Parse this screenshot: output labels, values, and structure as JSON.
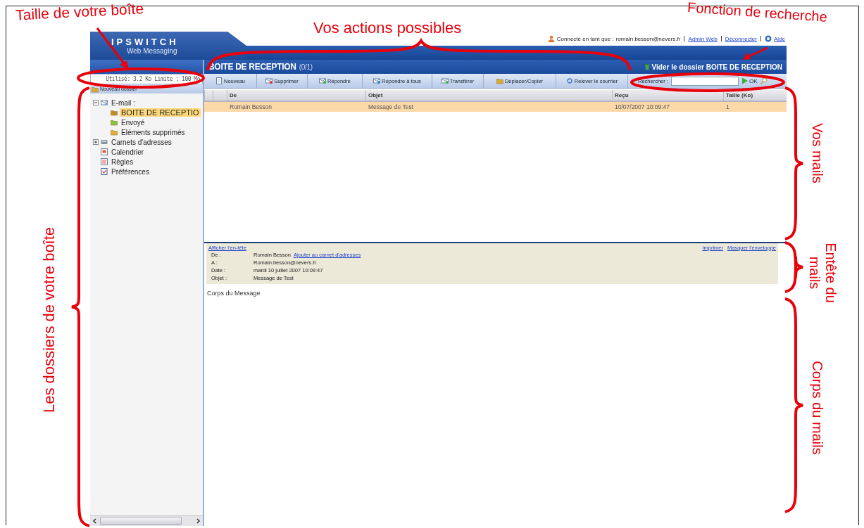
{
  "annotations": [
    {
      "kind": "horizontal",
      "lines": [
        "Taille de votre boîte"
      ]
    },
    {
      "kind": "horizontal",
      "lines": [
        "Vos actions possibles"
      ]
    },
    {
      "kind": "horizontal",
      "lines": [
        "Fonction de recherche"
      ]
    },
    {
      "kind": "vertical",
      "lines": [
        "Vos mails"
      ]
    },
    {
      "kind": "vertical",
      "lines": [
        "Entête du",
        "mails"
      ]
    },
    {
      "kind": "vertical",
      "lines": [
        "Corps  du mails"
      ]
    },
    {
      "kind": "vertical-up",
      "lines": [
        "Les dossiers de votre boîte"
      ]
    }
  ],
  "header": {
    "logo_title": "IPSWITCH",
    "logo_subtitle": "Web Messaging",
    "user_label": "Connecté en tant que :",
    "user_email": "romain.besson@nevers.fr",
    "links": [
      "Admin Web",
      "Déconnecter",
      "Aide"
    ]
  },
  "sidebar": {
    "quota": "Utilisé: 3.2 Ko Limite : 100 Mo",
    "new_folder": "Nouveau dossier",
    "tree": [
      {
        "label": "E-mail :",
        "expanded": true,
        "selected": false,
        "children": [
          {
            "label": "BOITE DE RECEPTIO",
            "selected": true
          },
          {
            "label": "Envoyé",
            "selected": false
          },
          {
            "label": "Eléments supprimés",
            "selected": false
          }
        ]
      },
      {
        "label": "Carnets d'adresses",
        "expanded": false,
        "selected": false
      },
      {
        "label": "Calendrier",
        "selected": false
      },
      {
        "label": "Règles",
        "selected": false
      },
      {
        "label": "Préférences",
        "selected": false
      }
    ]
  },
  "folder": {
    "title": "BOITE DE RECEPTION",
    "count": "(0/1)",
    "empty_action": "Vider le dossier BOITE DE RECEPTION"
  },
  "toolbar": [
    "Nouveau",
    "Supprimer",
    "Répondre",
    "Répondre à tous",
    "Transférer",
    "Déplacer/Copier",
    "Relever le courrier"
  ],
  "search": {
    "label": "Rechercher :",
    "button": "OK"
  },
  "table": {
    "columns": [
      "De",
      "Objet",
      "Reçu",
      "Taille (Ko)"
    ],
    "rows": [
      {
        "cells": [
          "Romain Besson",
          "Message de Test",
          "10/07/2007 10:09:47",
          "1"
        ],
        "selected": true
      }
    ]
  },
  "preview": {
    "show_header": "Afficher l'en-tête",
    "links": [
      "Imprimer",
      "Masquer l'enveloppe"
    ],
    "fields": [
      {
        "label": "De :",
        "value": "Romain Besson",
        "link": "Ajouter au carnet d'adresses"
      },
      {
        "label": "A :",
        "value": "Romain.besson@nevers.fr"
      },
      {
        "label": "Date :",
        "value": "mardi 10 juillet 2007 10:09:47"
      },
      {
        "label": "Objet :",
        "value": "Message de Test"
      }
    ],
    "body": "Corps du Message"
  }
}
